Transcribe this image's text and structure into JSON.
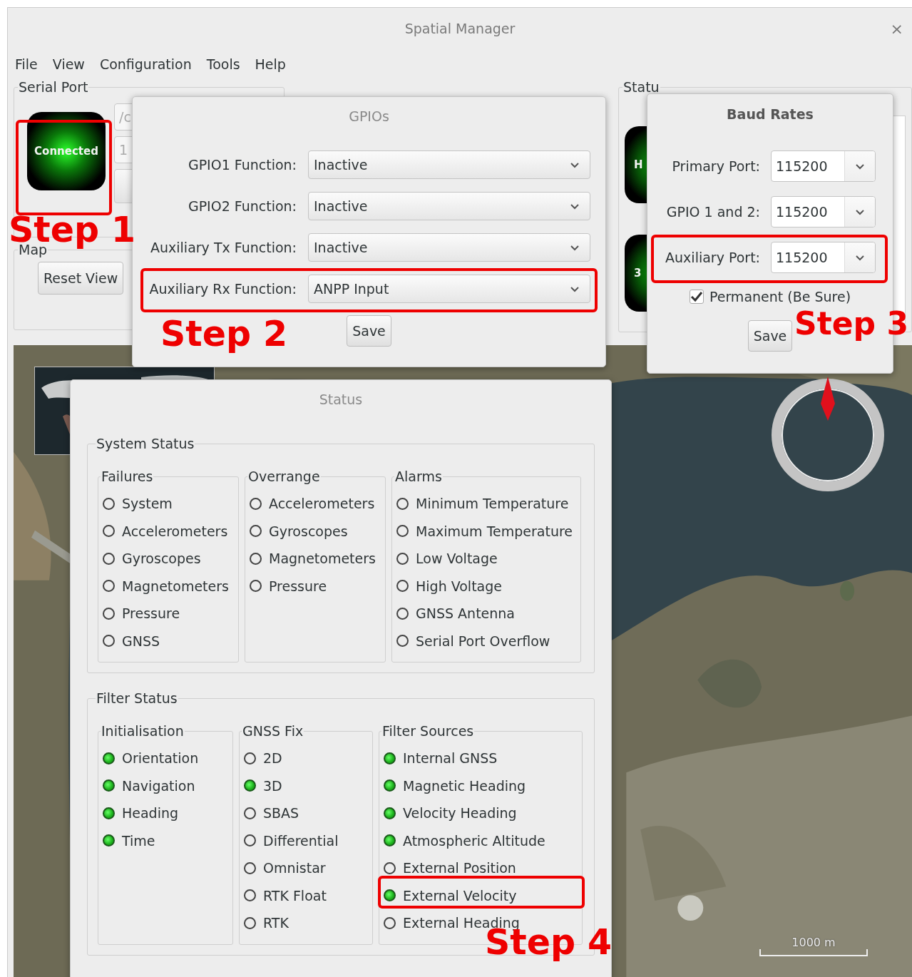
{
  "window": {
    "title": "Spatial Manager",
    "close": "×"
  },
  "menu": [
    "File",
    "View",
    "Configuration",
    "Tools",
    "Help"
  ],
  "serial_port": {
    "title": "Serial Port",
    "indicator": "Connected",
    "field_1": "/c",
    "field_2": "1"
  },
  "map_group": {
    "title": "Map",
    "button": "Reset View"
  },
  "status_group": {
    "title": "Statu",
    "indicator_1": "H",
    "indicator_2": "3"
  },
  "map": {
    "scale": "1000 m"
  },
  "gpios_dialog": {
    "title": "GPIOs",
    "rows": [
      {
        "label": "GPIO1 Function:",
        "value": "Inactive"
      },
      {
        "label": "GPIO2 Function:",
        "value": "Inactive"
      },
      {
        "label": "Auxiliary Tx Function:",
        "value": "Inactive"
      },
      {
        "label": "Auxiliary Rx Function:",
        "value": "ANPP Input"
      }
    ],
    "button": "Save"
  },
  "baud_dialog": {
    "title": "Baud Rates",
    "rows": [
      {
        "label": "Primary Port:",
        "value": "115200"
      },
      {
        "label": "GPIO 1 and 2:",
        "value": "115200"
      },
      {
        "label": "Auxiliary Port:",
        "value": "115200"
      }
    ],
    "checkbox": {
      "label": "Permanent (Be Sure)",
      "checked": true
    },
    "button": "Save"
  },
  "status_dialog": {
    "title": "Status",
    "sections": [
      {
        "title": "System Status",
        "groups": [
          {
            "title": "Failures",
            "items": [
              {
                "label": "System",
                "on": false
              },
              {
                "label": "Accelerometers",
                "on": false
              },
              {
                "label": "Gyroscopes",
                "on": false
              },
              {
                "label": "Magnetometers",
                "on": false
              },
              {
                "label": "Pressure",
                "on": false
              },
              {
                "label": "GNSS",
                "on": false
              }
            ]
          },
          {
            "title": "Overrange",
            "items": [
              {
                "label": "Accelerometers",
                "on": false
              },
              {
                "label": "Gyroscopes",
                "on": false
              },
              {
                "label": "Magnetometers",
                "on": false
              },
              {
                "label": "Pressure",
                "on": false
              }
            ]
          },
          {
            "title": "Alarms",
            "items": [
              {
                "label": "Minimum Temperature",
                "on": false
              },
              {
                "label": "Maximum Temperature",
                "on": false
              },
              {
                "label": "Low Voltage",
                "on": false
              },
              {
                "label": "High Voltage",
                "on": false
              },
              {
                "label": "GNSS Antenna",
                "on": false
              },
              {
                "label": "Serial Port Overflow",
                "on": false
              }
            ]
          }
        ]
      },
      {
        "title": "Filter Status",
        "groups": [
          {
            "title": "Initialisation",
            "items": [
              {
                "label": "Orientation",
                "on": true
              },
              {
                "label": "Navigation",
                "on": true
              },
              {
                "label": "Heading",
                "on": true
              },
              {
                "label": "Time",
                "on": true
              }
            ]
          },
          {
            "title": "GNSS Fix",
            "items": [
              {
                "label": "2D",
                "on": false
              },
              {
                "label": "3D",
                "on": true
              },
              {
                "label": "SBAS",
                "on": false
              },
              {
                "label": "Differential",
                "on": false
              },
              {
                "label": "Omnistar",
                "on": false
              },
              {
                "label": "RTK Float",
                "on": false
              },
              {
                "label": "RTK",
                "on": false
              }
            ]
          },
          {
            "title": "Filter Sources",
            "items": [
              {
                "label": "Internal GNSS",
                "on": true
              },
              {
                "label": "Magnetic Heading",
                "on": true
              },
              {
                "label": "Velocity Heading",
                "on": true
              },
              {
                "label": "Atmospheric Altitude",
                "on": true
              },
              {
                "label": "External Position",
                "on": false
              },
              {
                "label": "External Velocity",
                "on": true
              },
              {
                "label": "External Heading",
                "on": false
              }
            ]
          }
        ]
      }
    ]
  },
  "annotations": [
    {
      "label": "Step 1"
    },
    {
      "label": "Step 2"
    },
    {
      "label": "Step 3"
    },
    {
      "label": "Step 4"
    }
  ]
}
